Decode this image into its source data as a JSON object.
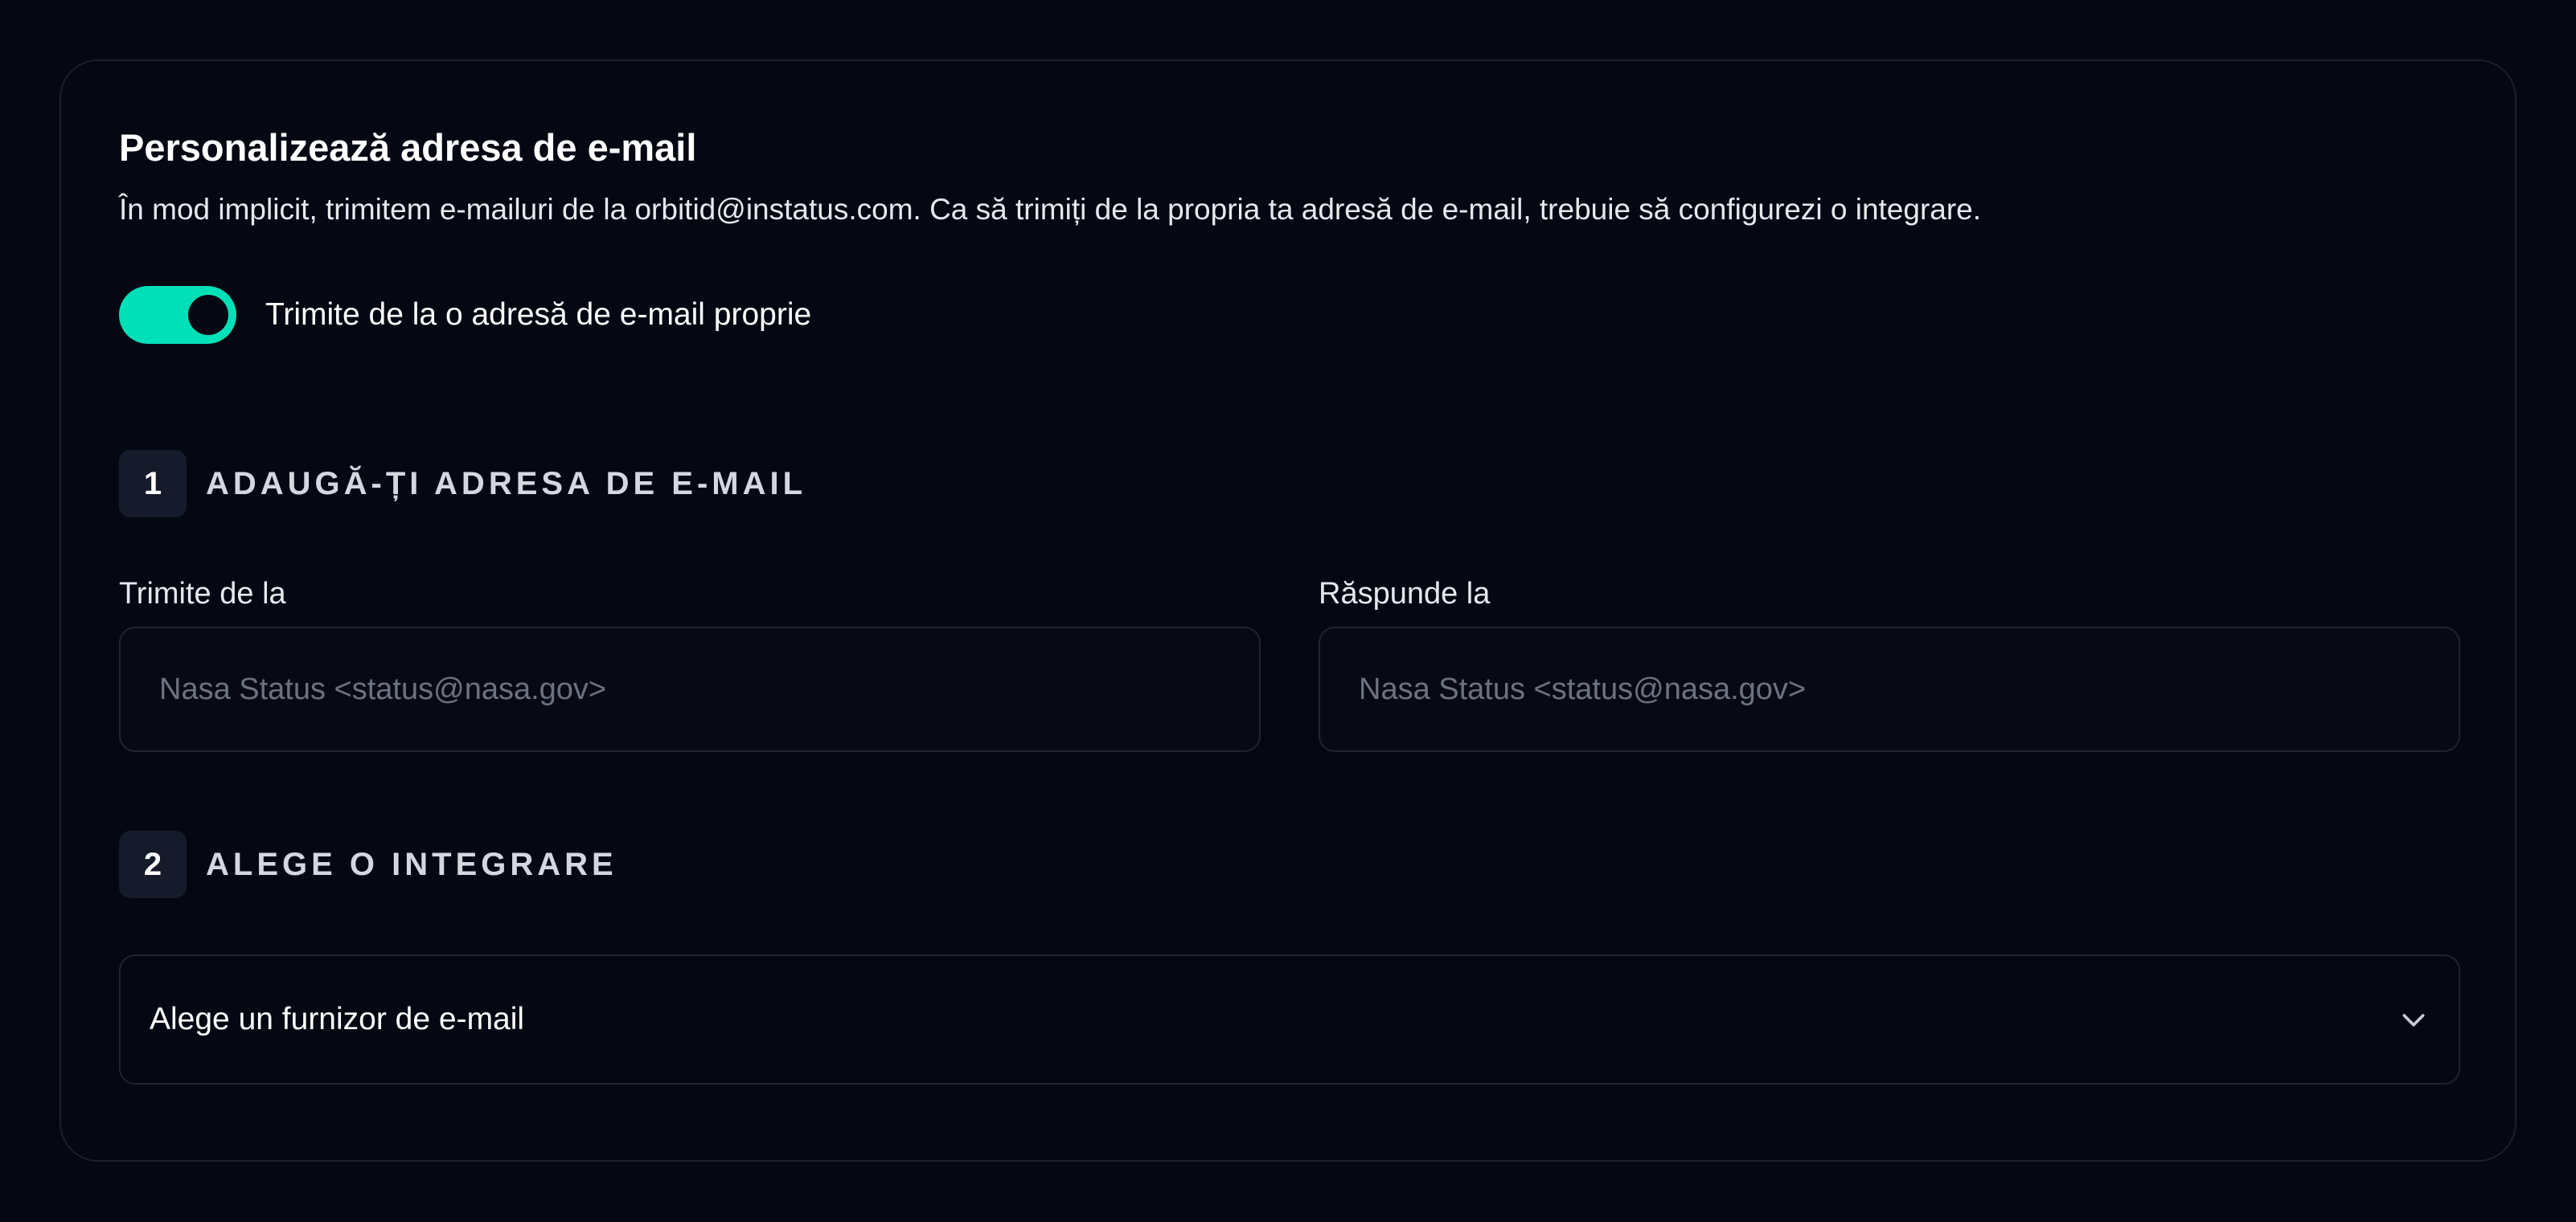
{
  "section": {
    "title": "Personalizează adresa de e-mail",
    "description": "În mod implicit, trimitem e-mailuri de la orbitid@instatus.com. Ca să trimiți de la propria ta adresă de e-mail, trebuie să configurezi o integrare."
  },
  "toggle": {
    "label": "Trimite de la o adresă de e-mail proprie",
    "enabled": true,
    "accent_color": "#00e0b8"
  },
  "step1": {
    "number": "1",
    "title": "ADAUGĂ-ȚI ADRESA DE E-MAIL",
    "from": {
      "label": "Trimite de la",
      "placeholder": "Nasa Status <status@nasa.gov>",
      "value": ""
    },
    "reply_to": {
      "label": "Răspunde la",
      "placeholder": "Nasa Status <status@nasa.gov>",
      "value": ""
    }
  },
  "step2": {
    "number": "2",
    "title": "ALEGE O INTEGRARE",
    "provider_select": {
      "value": "Alege un furnizor de e-mail",
      "icon": "chevron-down-icon"
    }
  }
}
